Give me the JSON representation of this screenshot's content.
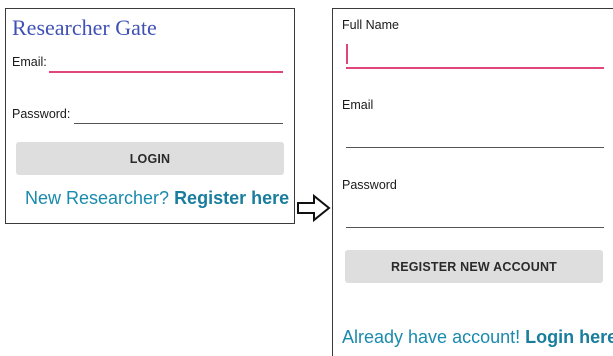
{
  "login": {
    "app_title": "Researcher Gate",
    "email_label": "Email:",
    "password_label": "Password:",
    "login_button": "LOGIN",
    "register_prompt": "New Researcher? ",
    "register_link": "Register here"
  },
  "register": {
    "full_name_label": "Full Name",
    "email_label": "Email",
    "password_label": "Password",
    "register_button": "REGISTER NEW ACCOUNT",
    "login_prompt": "Already have account! ",
    "login_link": "Login here"
  },
  "colors": {
    "title": "#3f51b5",
    "accent_underline": "#e0457b",
    "link": "#1a8aad",
    "button_bg": "#dedede"
  },
  "icons": {
    "transition_arrow": "right-arrow-icon"
  }
}
